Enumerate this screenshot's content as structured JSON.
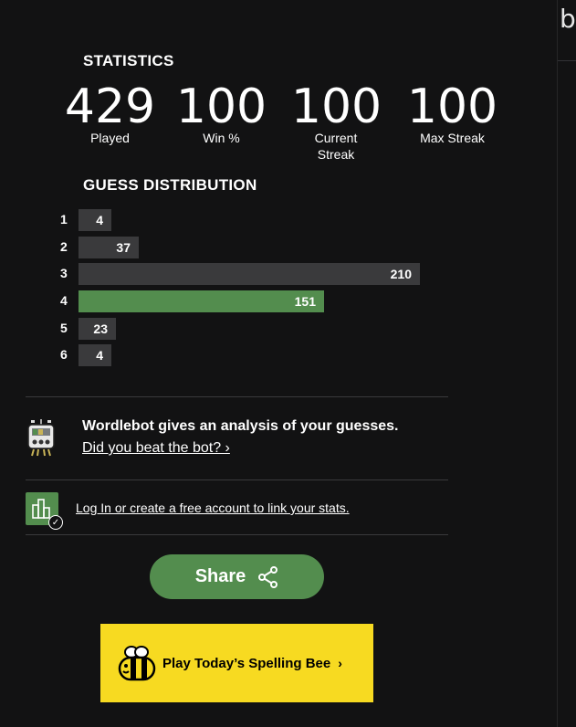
{
  "stats_title": "STATISTICS",
  "stats": [
    {
      "value": "429",
      "label": "Played"
    },
    {
      "value": "100",
      "label": "Win %"
    },
    {
      "value": "100",
      "label": "Current Streak"
    },
    {
      "value": "100",
      "label": "Max Streak"
    }
  ],
  "distribution_title": "GUESS DISTRIBUTION",
  "distribution": [
    {
      "guess": "1",
      "count": 4
    },
    {
      "guess": "2",
      "count": 37
    },
    {
      "guess": "3",
      "count": 210
    },
    {
      "guess": "4",
      "count": 151
    },
    {
      "guess": "5",
      "count": 23
    },
    {
      "guess": "6",
      "count": 4
    }
  ],
  "highlighted_guess": "4",
  "wordlebot": {
    "title": "Wordlebot gives an analysis of your guesses.",
    "link": "Did you beat the bot? ›"
  },
  "login": {
    "text": "Log In or create a free account to link your stats."
  },
  "share": {
    "label": "Share"
  },
  "spelling_bee": {
    "label": "Play Today’s Spelling Bee",
    "chevron": "›"
  },
  "colors": {
    "background": "#121213",
    "bar": "#3a3a3c",
    "bar_highlight": "#538d4e",
    "share": "#538d4e",
    "spelling_bee": "#f7da21"
  },
  "icons": [
    "wordlebot-icon",
    "stats-chart-icon",
    "checkmark-badge-icon",
    "share-icon",
    "bee-icon"
  ]
}
